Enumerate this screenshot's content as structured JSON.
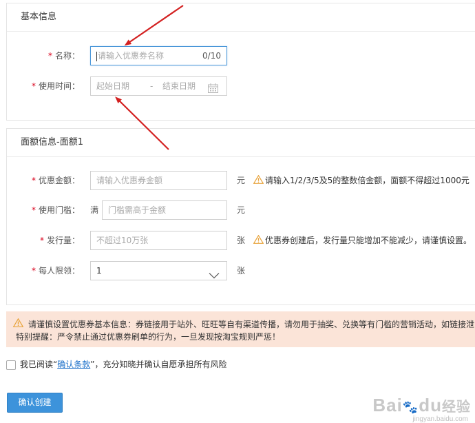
{
  "section_basic": {
    "title": "基本信息",
    "name_label": "名称：",
    "name_placeholder": "请输入优惠券名称",
    "name_counter": "0/10",
    "time_label": "使用时间：",
    "start_placeholder": "起始日期",
    "date_separator": "-",
    "end_placeholder": "结束日期"
  },
  "section_amount": {
    "title": "面额信息-面额1",
    "discount_label": "优惠金额：",
    "discount_placeholder": "请输入优惠券金额",
    "discount_unit": "元",
    "discount_tip": "请输入1/2/3/5及5的整数倍金额，面额不得超过1000元",
    "threshold_label": "使用门槛：",
    "threshold_prefix": "满",
    "threshold_placeholder": "门槛需高于金额",
    "threshold_unit": "元",
    "quantity_label": "发行量：",
    "quantity_placeholder": "不超过10万张",
    "quantity_unit": "张",
    "quantity_tip": "优惠券创建后，发行量只能增加不能减少，请谨慎设置。",
    "limit_label": "每人限领：",
    "limit_value": "1",
    "limit_unit": "张"
  },
  "required_mark": "*",
  "notice": {
    "line1": "请谨慎设置优惠券基本信息：券链接用于站外、旺旺等自有渠道传播，请勿用于抽奖、兑换等有门槛的营销活动，如链接泄",
    "line2": "特别提醒：严令禁止通过优惠券刷单的行为，一旦发现按淘宝规则严惩！"
  },
  "agreement": {
    "prefix": "我已阅读“",
    "link": "确认条款",
    "suffix": "”，充分知晓并确认自愿承担所有风险"
  },
  "submit_label": "确认创建",
  "watermark": {
    "logo_a": "Bai",
    "logo_b": "du",
    "logo_c": "经验",
    "sub": "jingyan.baidu.com"
  },
  "colors": {
    "required": "#d9001b",
    "button": "#3d93db",
    "notice_bg": "#fbe4d8",
    "warning": "#e8a33b",
    "arrow": "#d32020",
    "link": "#1a6fc9"
  },
  "icons": [
    "warning-icon",
    "calendar-icon",
    "chevron-down-icon",
    "checkbox"
  ]
}
